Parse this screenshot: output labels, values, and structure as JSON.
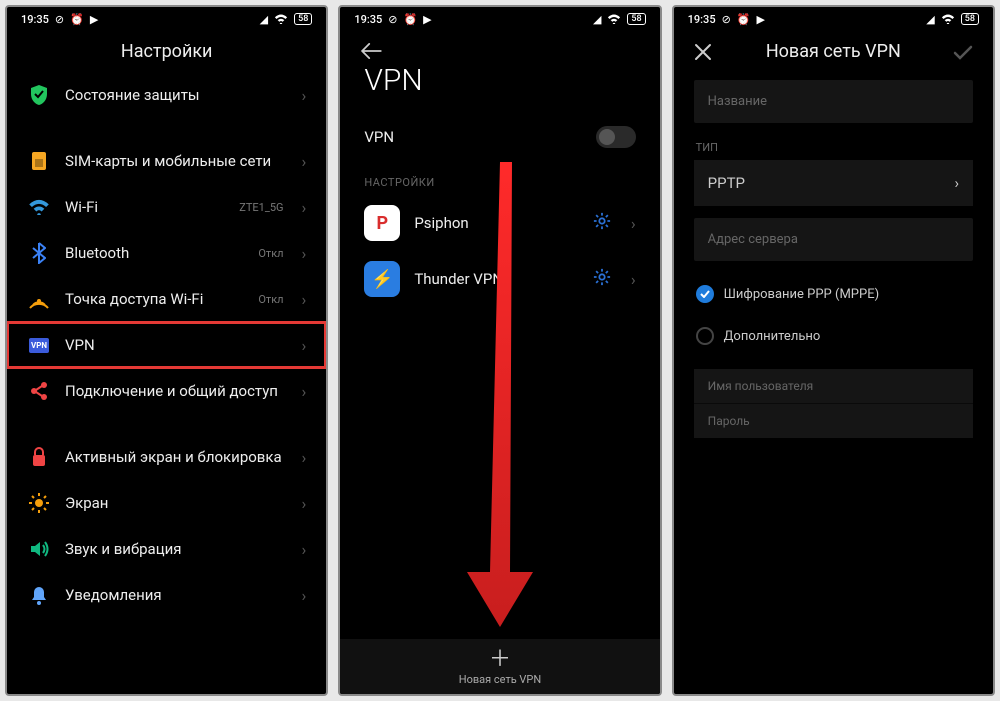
{
  "status": {
    "time": "19:35",
    "battery": "58"
  },
  "screen1": {
    "title": "Настройки",
    "items": [
      {
        "label": "Состояние защиты",
        "icon": "shield",
        "color": "#22c55e"
      },
      {
        "label": "SIM-карты и мобильные сети",
        "icon": "sim",
        "color": "#f5a623"
      },
      {
        "label": "Wi-Fi",
        "icon": "wifi",
        "color": "#3498db",
        "sub": "ZTE1_5G"
      },
      {
        "label": "Bluetooth",
        "icon": "bluetooth",
        "color": "#3b82f6",
        "sub": "Откл"
      },
      {
        "label": "Точка доступа Wi-Fi",
        "icon": "hotspot",
        "color": "#f59e0b",
        "sub": "Откл"
      },
      {
        "label": "VPN",
        "icon": "vpn",
        "color": "#3b5bdb",
        "highlight": true
      },
      {
        "label": "Подключение и общий доступ",
        "icon": "share",
        "color": "#ef4444"
      },
      {
        "label": "Активный экран и блокировка",
        "icon": "lock",
        "color": "#ef4444"
      },
      {
        "label": "Экран",
        "icon": "brightness",
        "color": "#f59e0b"
      },
      {
        "label": "Звук и вибрация",
        "icon": "sound",
        "color": "#10b981"
      },
      {
        "label": "Уведомления",
        "icon": "bell",
        "color": "#60a5fa"
      }
    ]
  },
  "screen2": {
    "big_title": "VPN",
    "toggle_label": "VPN",
    "section_label": "НАСТРОЙКИ",
    "apps": [
      {
        "label": "Psiphon",
        "icon_bg": "#ffffff",
        "icon_fg": "#d92d2d",
        "letter": "P"
      },
      {
        "label": "Thunder VPN",
        "icon_bg": "#2a7de1",
        "icon_fg": "#ffffff",
        "letter": "⚡"
      }
    ],
    "add_label": "Новая сеть VPN"
  },
  "screen3": {
    "title": "Новая сеть VPN",
    "name_placeholder": "Название",
    "type_label": "ТИП",
    "type_value": "PPTP",
    "server_placeholder": "Адрес сервера",
    "encrypt_label": "Шифрование PPP (MPPE)",
    "advanced_label": "Дополнительно",
    "username_label": "Имя пользователя",
    "password_label": "Пароль"
  }
}
